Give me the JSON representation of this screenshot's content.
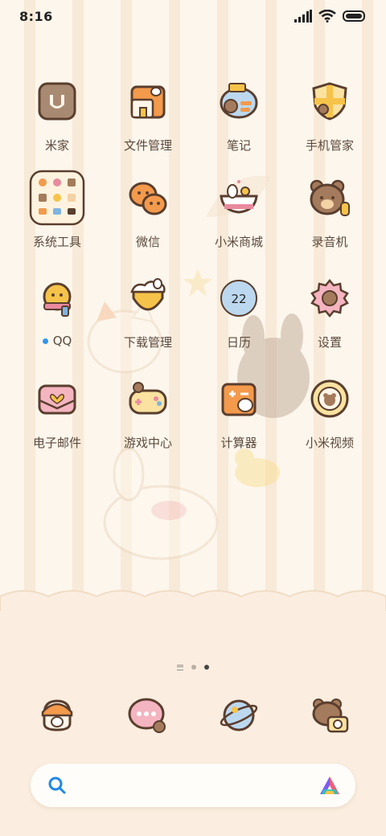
{
  "status_bar": {
    "time": "8:16",
    "icons": [
      "signal-icon",
      "wifi-icon",
      "battery-icon"
    ]
  },
  "apps": [
    {
      "label": "米家",
      "icon": "mijia-icon"
    },
    {
      "label": "文件管理",
      "icon": "file-manager-icon"
    },
    {
      "label": "笔记",
      "icon": "notes-icon"
    },
    {
      "label": "手机管家",
      "icon": "security-icon"
    },
    {
      "label": "系统工具",
      "icon": "system-tools-folder-icon"
    },
    {
      "label": "微信",
      "icon": "wechat-icon"
    },
    {
      "label": "小米商城",
      "icon": "mi-store-icon"
    },
    {
      "label": "录音机",
      "icon": "recorder-icon"
    },
    {
      "label": "QQ",
      "icon": "qq-icon",
      "new_dot_color": "#2f95f0"
    },
    {
      "label": "下载管理",
      "icon": "downloads-icon"
    },
    {
      "label": "日历",
      "icon": "calendar-icon",
      "badge": "22"
    },
    {
      "label": "设置",
      "icon": "settings-icon"
    },
    {
      "label": "电子邮件",
      "icon": "email-icon"
    },
    {
      "label": "游戏中心",
      "icon": "game-center-icon"
    },
    {
      "label": "计算器",
      "icon": "calculator-icon"
    },
    {
      "label": "小米视频",
      "icon": "mi-video-icon"
    }
  ],
  "pager": {
    "pages": 2,
    "active": 2
  },
  "dock": [
    "phone-icon",
    "messages-icon",
    "browser-icon",
    "camera-icon"
  ],
  "search": {
    "left_icon": "search-icon",
    "right_icon": "app-vault-icon"
  },
  "colors": {
    "accent_blue": "#2f95f0",
    "label_text": "#5b4a3e",
    "icon_outline": "#5a3e2e"
  }
}
